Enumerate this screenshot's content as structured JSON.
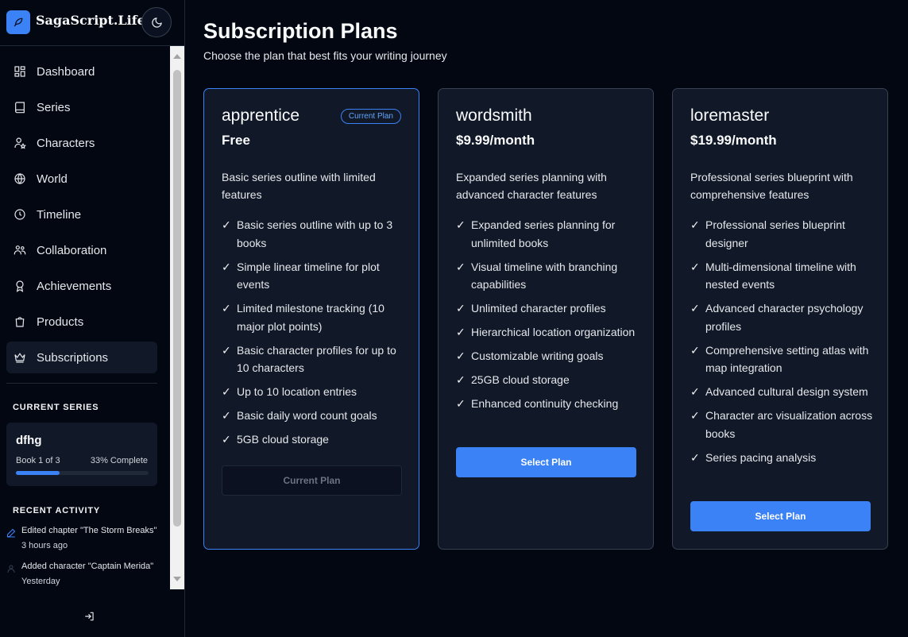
{
  "brand": {
    "name": "SagaScript.Life"
  },
  "nav": [
    {
      "label": "Dashboard",
      "icon": "dashboard-icon"
    },
    {
      "label": "Series",
      "icon": "book-icon"
    },
    {
      "label": "Characters",
      "icon": "user-star-icon"
    },
    {
      "label": "World",
      "icon": "globe-icon"
    },
    {
      "label": "Timeline",
      "icon": "clock-icon"
    },
    {
      "label": "Collaboration",
      "icon": "users-icon"
    },
    {
      "label": "Achievements",
      "icon": "award-icon"
    },
    {
      "label": "Products",
      "icon": "shopping-bag-icon"
    },
    {
      "label": "Subscriptions",
      "icon": "crown-icon",
      "active": true
    }
  ],
  "current_series": {
    "heading": "CURRENT SERIES",
    "name": "dfhg",
    "book": "Book 1 of 3",
    "complete": "33% Complete",
    "progress": 0.33
  },
  "recent_activity": {
    "heading": "RECENT ACTIVITY",
    "items": [
      {
        "text": "Edited chapter \"The Storm Breaks\"",
        "time": "3 hours ago",
        "icon": "pencil-icon"
      },
      {
        "text": "Added character \"Captain Merida\"",
        "time": "Yesterday",
        "icon": "user-icon"
      }
    ]
  },
  "header": {
    "title": "Subscription Plans",
    "subtitle": "Choose the plan that best fits your writing journey"
  },
  "plans": [
    {
      "name": "apprentice",
      "price": "Free",
      "badge": "Current Plan",
      "description": "Basic series outline with limited features",
      "features": [
        "Basic series outline with up to 3 books",
        "Simple linear timeline for plot events",
        "Limited milestone tracking (10 major plot points)",
        "Basic character profiles for up to 10 characters",
        "Up to 10 location entries",
        "Basic daily word count goals",
        "5GB cloud storage"
      ],
      "button": "Current Plan"
    },
    {
      "name": "wordsmith",
      "price": "$9.99/month",
      "description": "Expanded series planning with advanced character features",
      "features": [
        "Expanded series planning for unlimited books",
        "Visual timeline with branching capabilities",
        "Unlimited character profiles",
        "Hierarchical location organization",
        "Customizable writing goals",
        "25GB cloud storage",
        "Enhanced continuity checking"
      ],
      "button": "Select Plan"
    },
    {
      "name": "loremaster",
      "price": "$19.99/month",
      "description": "Professional series blueprint with comprehensive features",
      "features": [
        "Professional series blueprint designer",
        "Multi-dimensional timeline with nested events",
        "Advanced character psychology profiles",
        "Comprehensive setting atlas with map integration",
        "Advanced cultural design system",
        "Character arc visualization across books",
        "Series pacing analysis"
      ],
      "button": "Select Plan"
    }
  ],
  "colors": {
    "accent": "#3b82f6",
    "background": "#030712",
    "card": "#111827"
  }
}
